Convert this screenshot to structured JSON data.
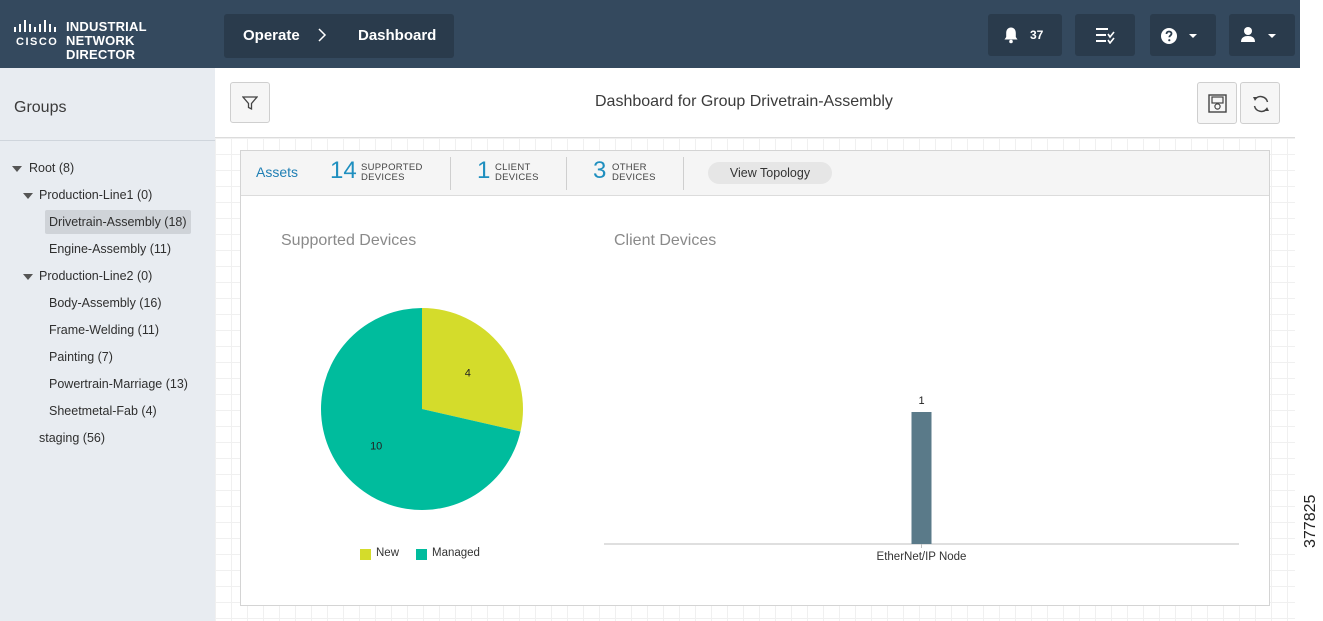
{
  "app": {
    "brand_line1": "INDUSTRIAL",
    "brand_line2": "NETWORK DIRECTOR",
    "brand_cisco": "CISCO"
  },
  "breadcrumb": [
    "Operate",
    "Dashboard"
  ],
  "toolbar": {
    "alerts_count": "37",
    "icons": [
      "bell-icon",
      "tasks-icon",
      "help-icon",
      "user-icon"
    ]
  },
  "sidebar": {
    "title": "Groups",
    "tree": [
      {
        "label": "Root (8)",
        "level": 0,
        "expanded": true
      },
      {
        "label": "Production-Line1 (0)",
        "level": 1,
        "expanded": true
      },
      {
        "label": "Drivetrain-Assembly (18)",
        "level": 2,
        "selected": true
      },
      {
        "label": "Engine-Assembly (11)",
        "level": 2
      },
      {
        "label": "Production-Line2 (0)",
        "level": 1,
        "expanded": true
      },
      {
        "label": "Body-Assembly (16)",
        "level": 2
      },
      {
        "label": "Frame-Welding (11)",
        "level": 2
      },
      {
        "label": "Painting (7)",
        "level": 2
      },
      {
        "label": "Powertrain-Marriage (13)",
        "level": 2
      },
      {
        "label": "Sheetmetal-Fab (4)",
        "level": 2
      },
      {
        "label": "staging (56)",
        "level": 1
      }
    ]
  },
  "main": {
    "title": "Dashboard for Group Drivetrain-Assembly",
    "assets": {
      "link": "Assets",
      "stats": [
        {
          "num": "14",
          "line1": "SUPPORTED",
          "line2": "DEVICES"
        },
        {
          "num": "1",
          "line1": "CLIENT",
          "line2": "DEVICES"
        },
        {
          "num": "3",
          "line1": "OTHER",
          "line2": "DEVICES"
        }
      ],
      "topology_button": "View Topology"
    }
  },
  "colors": {
    "new": "#d4dc2b",
    "managed": "#00bc9d",
    "bar": "#5a7a89",
    "accent": "#1f8fbf"
  },
  "chart_data": [
    {
      "type": "pie",
      "title": "Supported Devices",
      "categories": [
        "New",
        "Managed"
      ],
      "values": [
        4,
        10
      ],
      "legend": "bottom"
    },
    {
      "type": "bar",
      "title": "Client Devices",
      "categories": [
        "EtherNet/IP Node"
      ],
      "values": [
        1
      ]
    }
  ],
  "footer_id": "377825"
}
